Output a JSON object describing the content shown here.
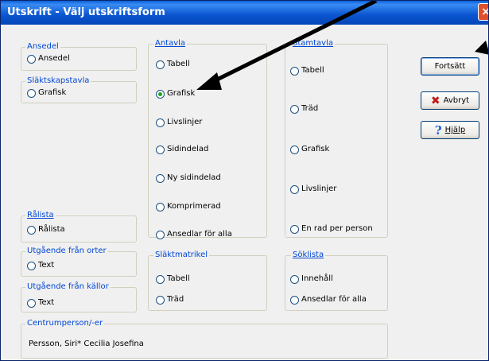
{
  "window": {
    "title": "Utskrift - Välj utskriftsform",
    "close_glyph": "×"
  },
  "groups": {
    "ansedel": {
      "label": "Ansedel",
      "options": [
        "Ansedel"
      ]
    },
    "slaktskapstavla": {
      "label": "Släktskapstavla",
      "options": [
        "Grafisk"
      ]
    },
    "antavla": {
      "label": "Antavla",
      "options": [
        "Tabell",
        "Grafisk",
        "Livslinjer",
        "Sidindelad",
        "Ny sidindelad",
        "Komprimerad",
        "Ansedlar för alla"
      ],
      "selected": "Grafisk"
    },
    "stamtavla": {
      "label": "Stamtavla",
      "options": [
        "Tabell",
        "Träd",
        "Grafisk",
        "Livslinjer",
        "En rad per person"
      ]
    },
    "ralista": {
      "label": "Rålista",
      "options": [
        "Rålista"
      ]
    },
    "orter": {
      "label": "Utgående från orter",
      "options": [
        "Text"
      ]
    },
    "kallor": {
      "label": "Utgående från källor",
      "options": [
        "Text"
      ]
    },
    "slaktmatrikel": {
      "label": "Släktmatrikel",
      "options": [
        "Tabell",
        "Träd"
      ]
    },
    "soklista": {
      "label": "Söklista",
      "options": [
        "Innehåll",
        "Ansedlar för alla"
      ]
    },
    "centrumperson": {
      "label": "Centrumperson/-er",
      "value": "Persson, Siri* Cecilia Josefina"
    }
  },
  "buttons": {
    "continue": "Fortsätt",
    "cancel": "Avbryt",
    "help": "Hjälp"
  },
  "colors": {
    "titlebar": "#0a55d0",
    "group_label": "#0046d5",
    "arrow": "#000000",
    "selected_dot": "#21a121"
  },
  "icons": {
    "cancel": "red-x-icon",
    "help": "question-mark-icon"
  }
}
